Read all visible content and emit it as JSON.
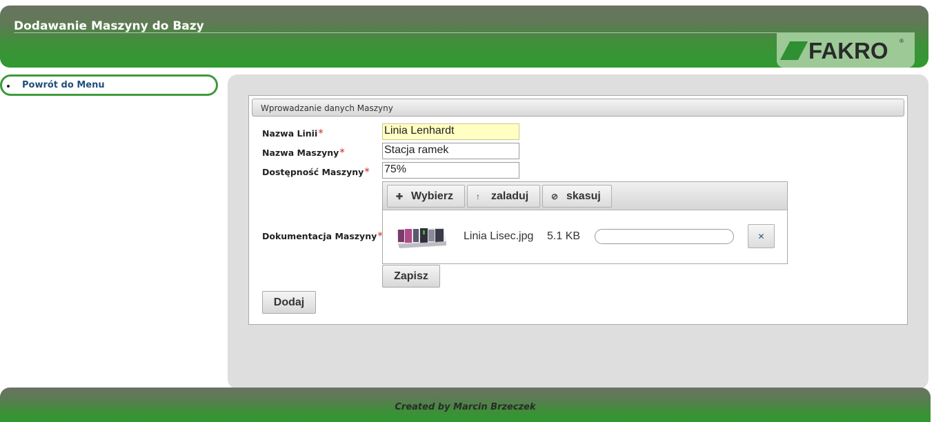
{
  "header": {
    "title": "Dodawanie Maszyny do Bazy",
    "logo_text": "FAKRO",
    "logo_mark": "®"
  },
  "sidebar": {
    "items": [
      {
        "label": "Powrót do Menu"
      }
    ]
  },
  "form": {
    "legend": "Wprowadzanie danych Maszyny",
    "required_mark": "*",
    "fields": [
      {
        "label": "Nazwa Linii",
        "value": "Linia Lenhardt"
      },
      {
        "label": "Nazwa Maszyny",
        "value": "Stacja ramek"
      },
      {
        "label": "Dostępność Maszyny",
        "value": "75%"
      }
    ],
    "upload": {
      "label": "Dokumentacja Maszyny",
      "choose_label": "Wybierz",
      "upload_label": "zaladuj",
      "cancel_label": "skasuj",
      "file": {
        "name": "Linia Lisec.jpg",
        "size": "5.1 KB",
        "progress": 0
      },
      "save_label": "Zapisz"
    },
    "submit_label": "Dodaj"
  },
  "footer": {
    "text": "Created by Marcin Brzeczek"
  },
  "colors": {
    "brand_green": "#2f9a2f",
    "header_gray": "#6a7361",
    "logo_bg": "#9cc996",
    "link_blue": "#1f4f7a",
    "required_red": "#cc2a2a",
    "focus_yellow": "#ffffc4"
  },
  "icons": {
    "choose": "plus-icon",
    "upload": "upload-arrow-icon",
    "cancel": "cancel-circle-icon",
    "remove": "close-icon"
  }
}
